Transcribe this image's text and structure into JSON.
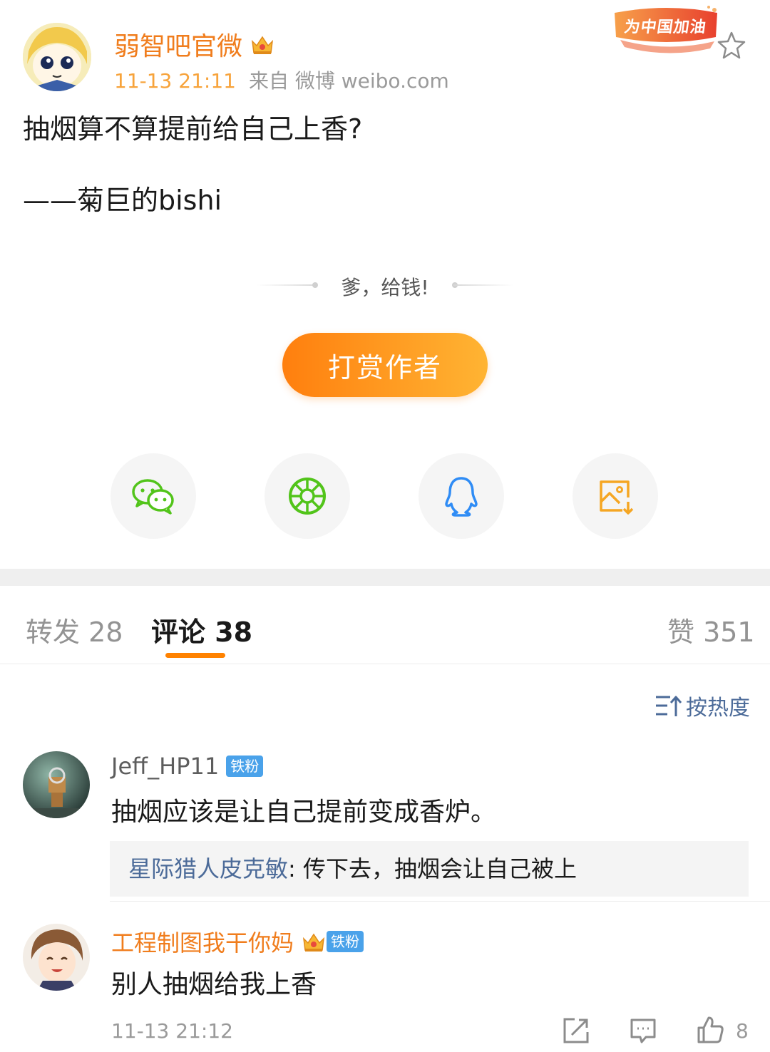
{
  "post": {
    "author": "弱智吧官微",
    "time": "11-13 21:11",
    "source": "来自 微博 weibo.com",
    "promo_badge": "为中国加油",
    "lines": [
      "抽烟算不算提前给自己上香?",
      "——菊巨的bishi"
    ]
  },
  "reward": {
    "slogan": "爹，给钱!",
    "button_label": "打赏作者"
  },
  "share": {
    "items": [
      {
        "name": "wechat",
        "icon": "wechat-icon",
        "color": "#52c41a"
      },
      {
        "name": "moments",
        "icon": "moments-icon",
        "color": "#52c41a"
      },
      {
        "name": "qq",
        "icon": "qq-icon",
        "color": "#2f8cf5"
      },
      {
        "name": "save-image",
        "icon": "save-image-icon",
        "color": "#f5a623"
      }
    ]
  },
  "tabs": {
    "reposts": "转发 28",
    "comments": "评论 38",
    "likes": "赞 351"
  },
  "sort": {
    "label": "按热度"
  },
  "comments": [
    {
      "user": "Jeff_HP11",
      "badge": "铁粉",
      "text": "抽烟应该是让自己提前变成香炉。",
      "reply_user": "星际猎人皮克敏",
      "reply_text": ": 传下去，抽烟会让自己被上"
    },
    {
      "user": "工程制图我干你妈",
      "badge": "铁粉",
      "text": "别人抽烟给我上香",
      "time": "11-13 21:12",
      "likes": "8"
    }
  ],
  "colors": {
    "accent": "#ff8200",
    "link": "#4c6b99",
    "vip_name": "#f07d1d",
    "fan_badge": "#4aa2ea"
  }
}
